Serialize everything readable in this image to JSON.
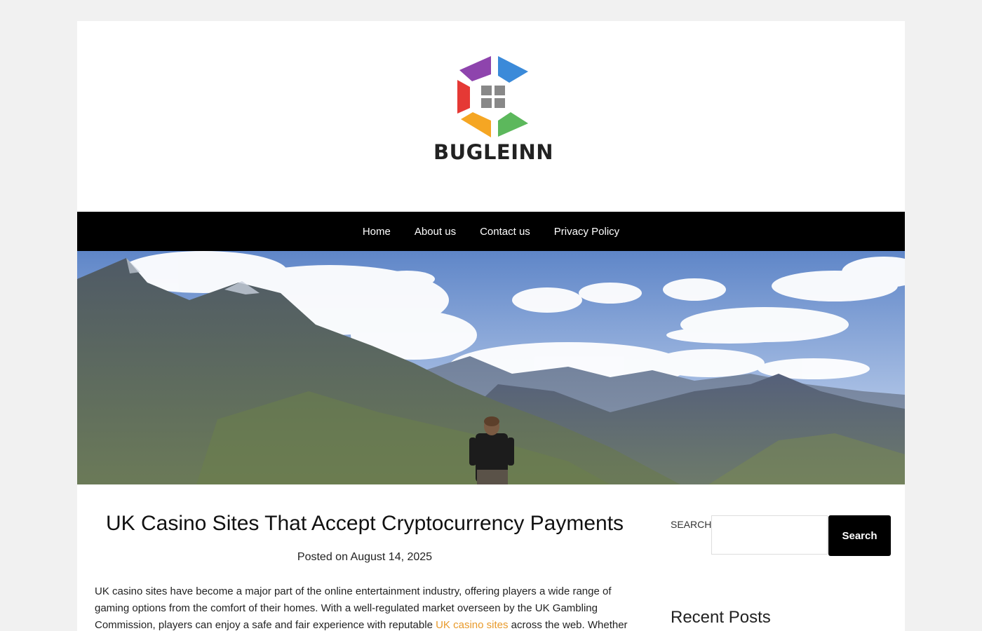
{
  "site": {
    "logo_text": "BUGLEINN",
    "logo_colors": [
      "#8e44ad",
      "#3b8ad9",
      "#e53935",
      "#f5a623",
      "#5cb85c",
      "#888888"
    ]
  },
  "nav": {
    "items": [
      "Home",
      "About us",
      "Contact us",
      "Privacy Policy"
    ]
  },
  "post": {
    "title": "UK Casino Sites That Accept Cryptocurrency Payments",
    "meta_prefix": "Posted on",
    "date": "August 14, 2025",
    "excerpt_part1": "UK casino sites have become a major part of the online entertainment industry, offering players a wide range of gaming options from the comfort of their homes. With a well-regulated market overseen by the UK Gambling Commission, players can enjoy a safe and fair experience with reputable",
    "excerpt_link": "UK casino sites",
    "excerpt_part2": "across the web. Whether"
  },
  "sidebar": {
    "search_label": "SEARCH",
    "search_button": "Search",
    "search_value": "",
    "recent_posts_title": "Recent Posts"
  }
}
